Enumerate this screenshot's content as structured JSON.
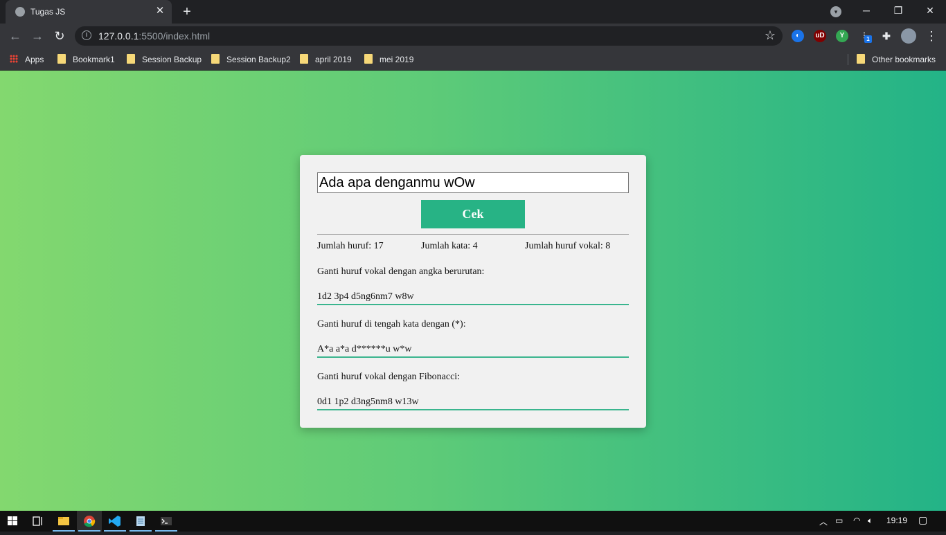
{
  "browser": {
    "tab": {
      "title": "Tugas JS"
    },
    "address": {
      "host": "127.0.0.1",
      "rest": ":5500/index.html"
    },
    "bookmarks": [
      {
        "label": "Apps",
        "kind": "apps"
      },
      {
        "label": "Bookmark1",
        "kind": "folder"
      },
      {
        "label": "Session Backup",
        "kind": "folder"
      },
      {
        "label": "Session Backup2",
        "kind": "folder"
      },
      {
        "label": "april 2019",
        "kind": "folder"
      },
      {
        "label": "mei 2019",
        "kind": "folder"
      }
    ],
    "other_bookmarks": "Other bookmarks",
    "extensions": [
      {
        "name": "extension-blue-icon",
        "color": "#1a73e8"
      },
      {
        "name": "ublock-icon",
        "label": "uD",
        "color": "#800000"
      },
      {
        "name": "extension-green-icon",
        "color": "#34a853"
      },
      {
        "name": "extension-badge-icon",
        "badge": "1",
        "color": "#4a4a4a"
      }
    ]
  },
  "app": {
    "input_value": "Ada apa denganmu wOw",
    "button_label": "Cek",
    "stats": {
      "huruf": "Jumlah huruf: 17",
      "kata": "Jumlah kata: 4",
      "vokal": "Jumlah huruf vokal: 8"
    },
    "sections": [
      {
        "label": "Ganti huruf vokal dengan angka berurutan:",
        "result": "1d2 3p4 d5ng6nm7 w8w"
      },
      {
        "label": "Ganti huruf di tengah kata dengan (*):",
        "result": "A*a a*a d******u w*w"
      },
      {
        "label": "Ganti huruf vokal dengan Fibonacci:",
        "result": "0d1 1p2 d3ng5nm8 w13w"
      }
    ]
  },
  "taskbar": {
    "clock": "19:19"
  },
  "colors": {
    "accent": "#27b385",
    "gradient_start": "#83d86f",
    "gradient_end": "#23b387"
  }
}
